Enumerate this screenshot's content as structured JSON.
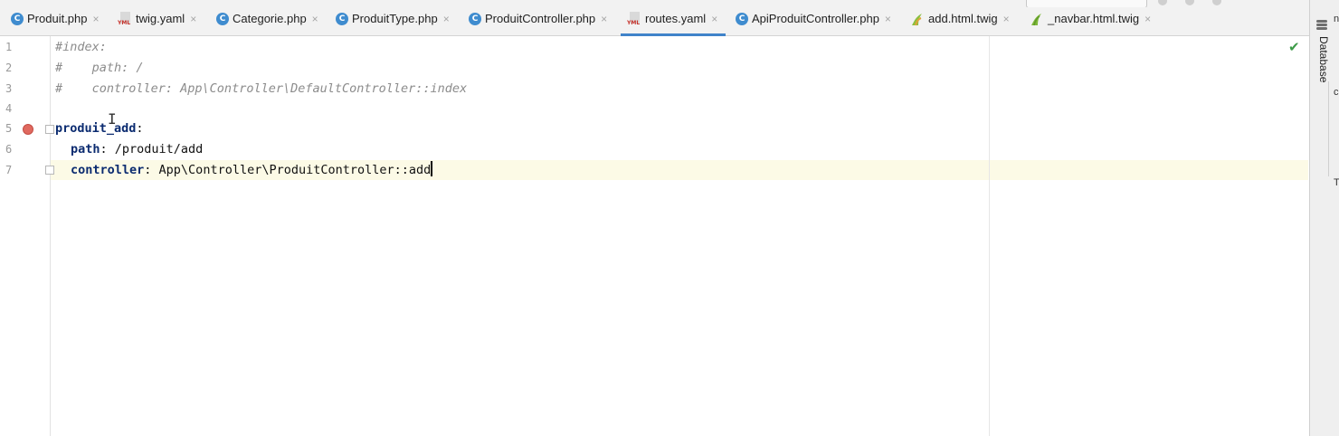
{
  "tabs": [
    {
      "label": "Produit.php",
      "icon": "php-class-icon",
      "active": false
    },
    {
      "label": "twig.yaml",
      "icon": "yaml-file-icon",
      "active": false
    },
    {
      "label": "Categorie.php",
      "icon": "php-class-icon",
      "active": false
    },
    {
      "label": "ProduitType.php",
      "icon": "php-class-icon",
      "active": false
    },
    {
      "label": "ProduitController.php",
      "icon": "php-class-icon",
      "active": false
    },
    {
      "label": "routes.yaml",
      "icon": "yaml-file-icon",
      "active": true
    },
    {
      "label": "ApiProduitController.php",
      "icon": "php-class-icon",
      "active": false
    },
    {
      "label": "add.html.twig",
      "icon": "twig-file-icon",
      "active": false
    },
    {
      "label": "_navbar.html.twig",
      "icon": "twig-file-icon",
      "active": false
    }
  ],
  "icon_glyphs": {
    "php_class": "C",
    "yaml": "YML",
    "close": "×",
    "check": "✔",
    "ibeam": "I"
  },
  "editor": {
    "lines": [
      {
        "num": "1",
        "text": "#index:"
      },
      {
        "num": "2",
        "text": "#    path: /"
      },
      {
        "num": "3",
        "text": "#    controller: App\\Controller\\DefaultController::index"
      },
      {
        "num": "4",
        "text": ""
      },
      {
        "num": "5",
        "key": "produit_add",
        "sep": ":"
      },
      {
        "num": "6",
        "key": "path",
        "sep": ": ",
        "value": "/produit/add"
      },
      {
        "num": "7",
        "key": "controller",
        "sep": ": ",
        "value": "App\\Controller\\ProduitController::add"
      }
    ]
  },
  "side_panel": {
    "database_label": "Database",
    "fragments": [
      "ny",
      "co",
      "Ti"
    ]
  },
  "colors": {
    "active_tab_underline": "#4083c9",
    "php_icon": "#3f8ccf",
    "current_line": "#fcfae6",
    "yaml_key": "#0b2b70",
    "comment": "#8c8c8c"
  }
}
